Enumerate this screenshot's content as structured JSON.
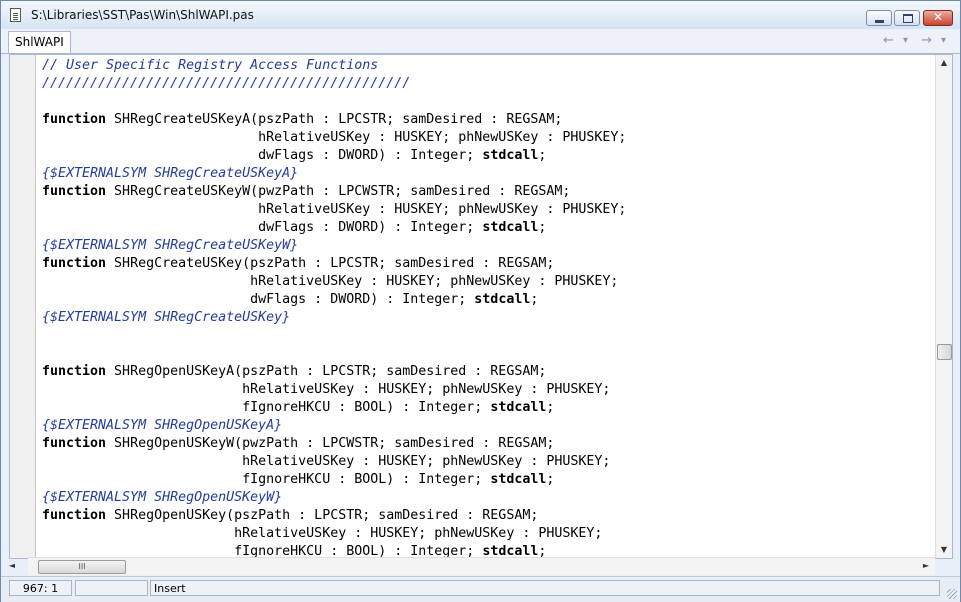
{
  "window": {
    "title": "S:\\Libraries\\SST\\Pas\\Win\\ShlWAPI.pas",
    "close_glyph": "✕"
  },
  "tabs": [
    {
      "label": "ShlWAPI"
    }
  ],
  "nav": {
    "back_icon": "←",
    "back_dropdown_icon": "▾",
    "forward_icon": "→",
    "forward_dropdown_icon": "▾"
  },
  "editor": {
    "lines": [
      [
        [
          "c",
          "// User Specific Registry Access Functions"
        ]
      ],
      [
        [
          "c",
          "//////////////////////////////////////////////"
        ]
      ],
      [
        [
          "n",
          ""
        ]
      ],
      [
        [
          "k",
          "function"
        ],
        [
          "n",
          " SHRegCreateUSKeyA(pszPath : LPCSTR; samDesired : REGSAM;"
        ]
      ],
      [
        [
          "n",
          "                           hRelativeUSKey : HUSKEY; phNewUSKey : PHUSKEY;"
        ]
      ],
      [
        [
          "n",
          "                           dwFlags : DWORD) : Integer; "
        ],
        [
          "k",
          "stdcall"
        ],
        [
          "n",
          ";"
        ]
      ],
      [
        [
          "c",
          "{$EXTERNALSYM SHRegCreateUSKeyA}"
        ]
      ],
      [
        [
          "k",
          "function"
        ],
        [
          "n",
          " SHRegCreateUSKeyW(pwzPath : LPCWSTR; samDesired : REGSAM;"
        ]
      ],
      [
        [
          "n",
          "                           hRelativeUSKey : HUSKEY; phNewUSKey : PHUSKEY;"
        ]
      ],
      [
        [
          "n",
          "                           dwFlags : DWORD) : Integer; "
        ],
        [
          "k",
          "stdcall"
        ],
        [
          "n",
          ";"
        ]
      ],
      [
        [
          "c",
          "{$EXTERNALSYM SHRegCreateUSKeyW}"
        ]
      ],
      [
        [
          "k",
          "function"
        ],
        [
          "n",
          " SHRegCreateUSKey(pszPath : LPCSTR; samDesired : REGSAM;"
        ]
      ],
      [
        [
          "n",
          "                          hRelativeUSKey : HUSKEY; phNewUSKey : PHUSKEY;"
        ]
      ],
      [
        [
          "n",
          "                          dwFlags : DWORD) : Integer; "
        ],
        [
          "k",
          "stdcall"
        ],
        [
          "n",
          ";"
        ]
      ],
      [
        [
          "c",
          "{$EXTERNALSYM SHRegCreateUSKey}"
        ]
      ],
      [
        [
          "n",
          ""
        ]
      ],
      [
        [
          "n",
          ""
        ]
      ],
      [
        [
          "k",
          "function"
        ],
        [
          "n",
          " SHRegOpenUSKeyA(pszPath : LPCSTR; samDesired : REGSAM;"
        ]
      ],
      [
        [
          "n",
          "                         hRelativeUSKey : HUSKEY; phNewUSKey : PHUSKEY;"
        ]
      ],
      [
        [
          "n",
          "                         fIgnoreHKCU : BOOL) : Integer; "
        ],
        [
          "k",
          "stdcall"
        ],
        [
          "n",
          ";"
        ]
      ],
      [
        [
          "c",
          "{$EXTERNALSYM SHRegOpenUSKeyA}"
        ]
      ],
      [
        [
          "k",
          "function"
        ],
        [
          "n",
          " SHRegOpenUSKeyW(pwzPath : LPCWSTR; samDesired : REGSAM;"
        ]
      ],
      [
        [
          "n",
          "                         hRelativeUSKey : HUSKEY; phNewUSKey : PHUSKEY;"
        ]
      ],
      [
        [
          "n",
          "                         fIgnoreHKCU : BOOL) : Integer; "
        ],
        [
          "k",
          "stdcall"
        ],
        [
          "n",
          ";"
        ]
      ],
      [
        [
          "c",
          "{$EXTERNALSYM SHRegOpenUSKeyW}"
        ]
      ],
      [
        [
          "k",
          "function"
        ],
        [
          "n",
          " SHRegOpenUSKey(pszPath : LPCSTR; samDesired : REGSAM;"
        ]
      ],
      [
        [
          "n",
          "                        hRelativeUSKey : HUSKEY; phNewUSKey : PHUSKEY;"
        ]
      ],
      [
        [
          "n",
          "                        fIgnoreHKCU : BOOL) : Integer; "
        ],
        [
          "k",
          "stdcall"
        ],
        [
          "n",
          ";"
        ]
      ]
    ],
    "vscroll": {
      "up_icon": "▲",
      "down_icon": "▼",
      "position": 0.6
    },
    "hscroll": {
      "left_icon": "◄",
      "right_icon": "►",
      "thumb_grip": "III"
    }
  },
  "status": {
    "position": "967:  1",
    "mode": "Insert"
  },
  "colors": {
    "comment": "#233c9a",
    "keyword": "#000000",
    "text": "#000000"
  }
}
